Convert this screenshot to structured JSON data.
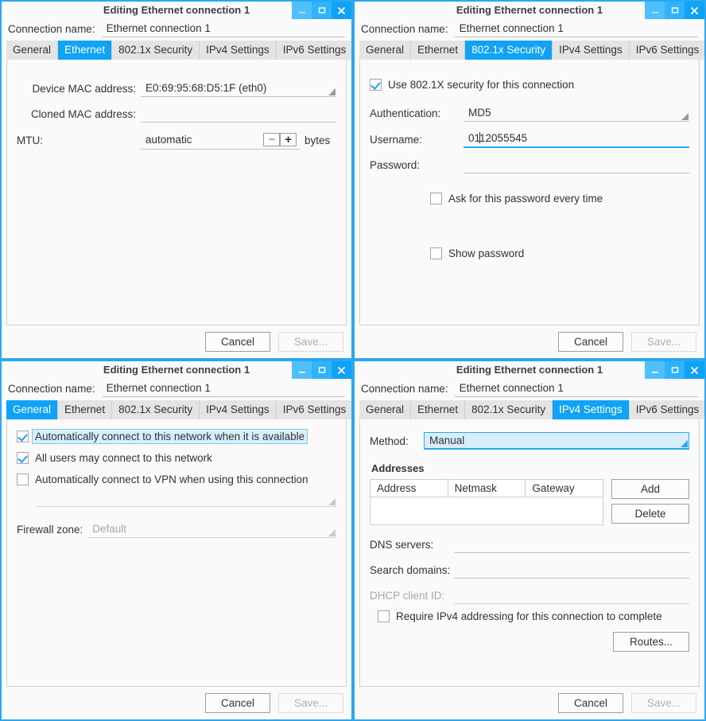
{
  "window_title": "Editing Ethernet connection 1",
  "window_controls": {
    "minimize": "minimize-icon",
    "maximize": "maximize-icon",
    "close": "close-icon"
  },
  "connection": {
    "label": "Connection name:",
    "value": "Ethernet connection 1"
  },
  "tabs": [
    "General",
    "Ethernet",
    "802.1x Security",
    "IPv4 Settings",
    "IPv6 Settings"
  ],
  "actions": {
    "cancel": "Cancel",
    "save": "Save..."
  },
  "colors": {
    "accent": "#0fa2f5",
    "titlebar": "#fafafa",
    "tabstrip": "#e4e4e4",
    "focus_fill": "#d9eefb"
  },
  "ethernet_tab": {
    "active_tab": "Ethernet",
    "device_mac_label": "Device MAC address:",
    "device_mac_value": "E0:69:95:68:D5:1F (eth0)",
    "cloned_mac_label": "Cloned MAC address:",
    "cloned_mac_value": "",
    "mtu_label": "MTU:",
    "mtu_value": "automatic",
    "mtu_minus": "−",
    "mtu_plus": "+",
    "mtu_units": "bytes"
  },
  "security_tab": {
    "active_tab": "802.1x Security",
    "use_security_label": "Use 802.1X security for this connection",
    "use_security_checked": true,
    "authentication_label": "Authentication:",
    "authentication_value": "MD5",
    "username_label": "Username:",
    "username_value_before_caret": "01",
    "username_value_after_caret": "12055545",
    "password_label": "Password:",
    "password_value": "",
    "ask_password_label": "Ask for this password every time",
    "ask_password_checked": false,
    "show_password_label": "Show password",
    "show_password_checked": false
  },
  "general_tab": {
    "active_tab": "General",
    "auto_connect_label": "Automatically connect to this network when it is available",
    "auto_connect_checked": true,
    "all_users_label": "All users may connect to this network",
    "all_users_checked": true,
    "auto_vpn_label": "Automatically connect to VPN when using this connection",
    "auto_vpn_checked": false,
    "vpn_combo_value": "",
    "firewall_label": "Firewall zone:",
    "firewall_value": "Default"
  },
  "ipv4_tab": {
    "active_tab": "IPv4 Settings",
    "method_label": "Method:",
    "method_value": "Manual",
    "addresses_title": "Addresses",
    "columns": [
      "Address",
      "Netmask",
      "Gateway"
    ],
    "rows": [],
    "add_button": "Add",
    "delete_button": "Delete",
    "dns_label": "DNS servers:",
    "dns_value": "",
    "search_label": "Search domains:",
    "search_value": "",
    "dhcp_label": "DHCP client ID:",
    "dhcp_value": "",
    "require_ipv4_label": "Require IPv4 addressing for this connection to complete",
    "require_ipv4_checked": false,
    "routes_button": "Routes..."
  }
}
